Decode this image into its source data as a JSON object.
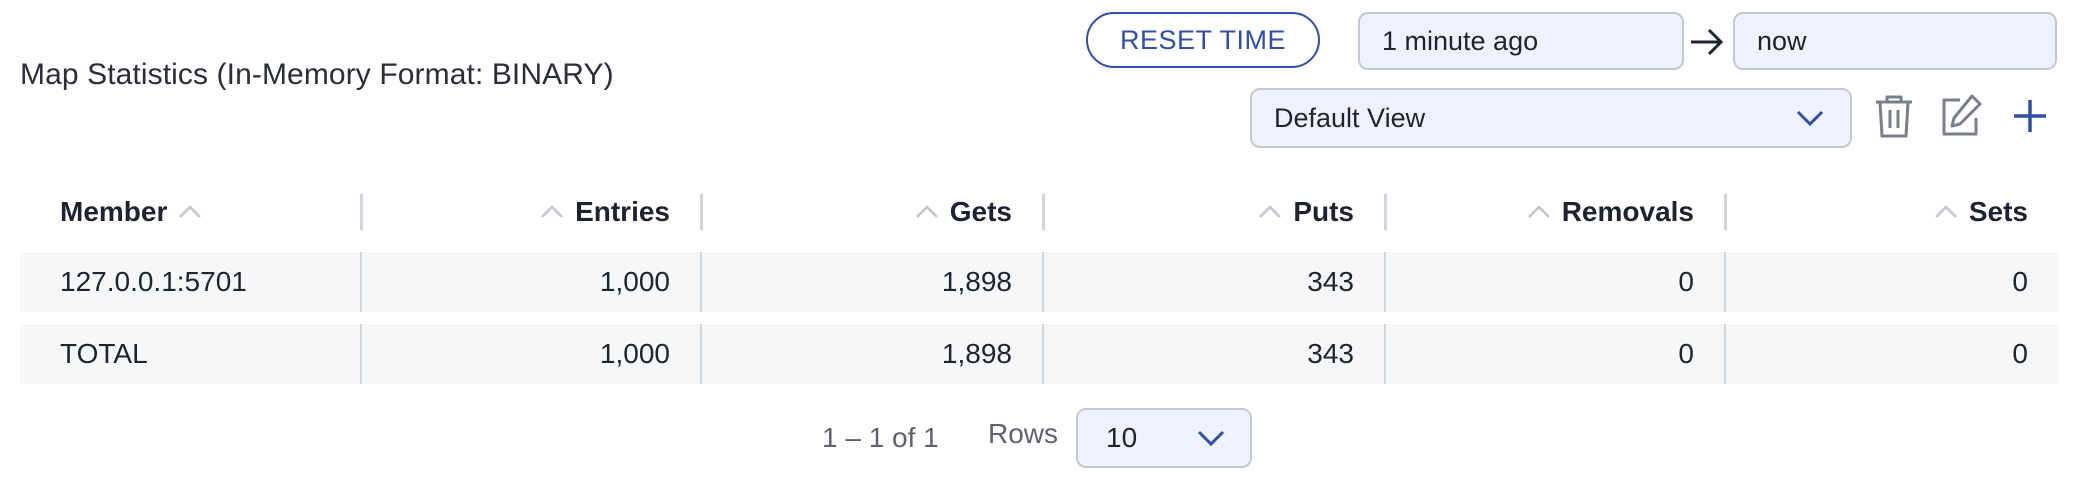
{
  "title": "Map Statistics (In-Memory Format: BINARY)",
  "toolbar": {
    "reset_label": "RESET TIME",
    "time_from": "1 minute ago",
    "time_to": "now",
    "view": "Default View"
  },
  "table": {
    "columns": [
      "Member",
      "Entries",
      "Gets",
      "Puts",
      "Removals",
      "Sets"
    ],
    "rows": [
      [
        "127.0.0.1:5701",
        "1,000",
        "1,898",
        "343",
        "0",
        "0"
      ],
      [
        "TOTAL",
        "1,000",
        "1,898",
        "343",
        "0",
        "0"
      ]
    ]
  },
  "pagination": {
    "range": "1 – 1 of 1",
    "rows_label": "Rows",
    "rows_per_page": "10"
  },
  "colors": {
    "accent": "#2f4fa8",
    "field_bg": "#eef2fc",
    "row_bg": "#f6f7f9"
  }
}
